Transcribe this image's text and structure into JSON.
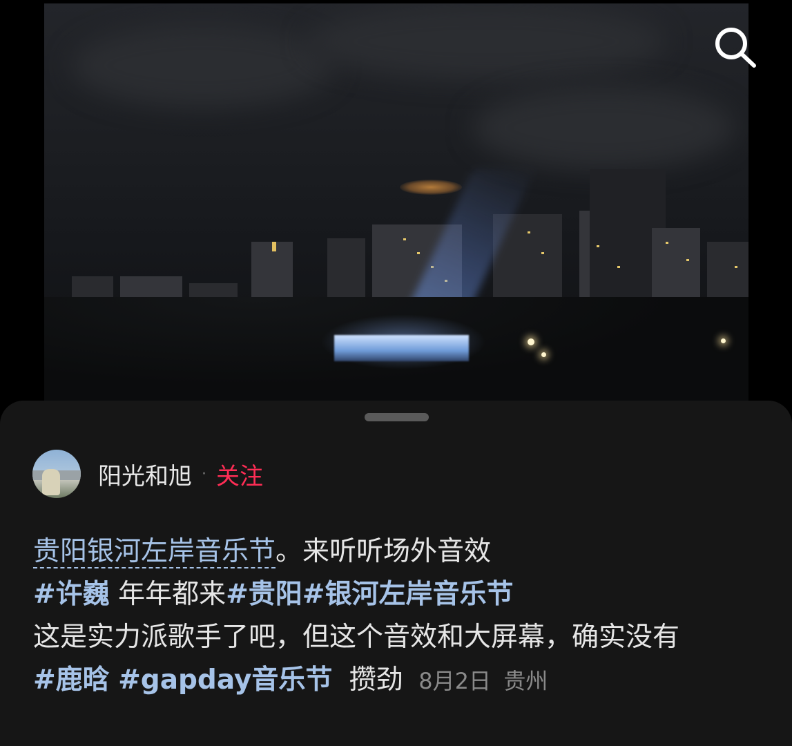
{
  "header": {
    "search_icon": "search-icon"
  },
  "post": {
    "author": "阳光和旭",
    "separator": "·",
    "follow_label": "关注",
    "line1": {
      "title_link": "贵阳银河左岸音乐节",
      "text": "。来听听场外音效"
    },
    "line2": {
      "tag1": "#许巍",
      "text": " 年年都来",
      "tag2": "#贵阳",
      "tag3": "#银河左岸音乐节"
    },
    "line3": "这是实力派歌手了吧，但这个音效和大屏幕，确实没有",
    "line4": {
      "tag1": "#鹿晗",
      "tag2": "#gapday音乐节",
      "text": "攒劲",
      "date": "8月2日",
      "location": "贵州"
    }
  },
  "colors": {
    "accent_follow": "#ff2d55",
    "link": "#a6c3e8",
    "sheet_bg": "#161616"
  }
}
